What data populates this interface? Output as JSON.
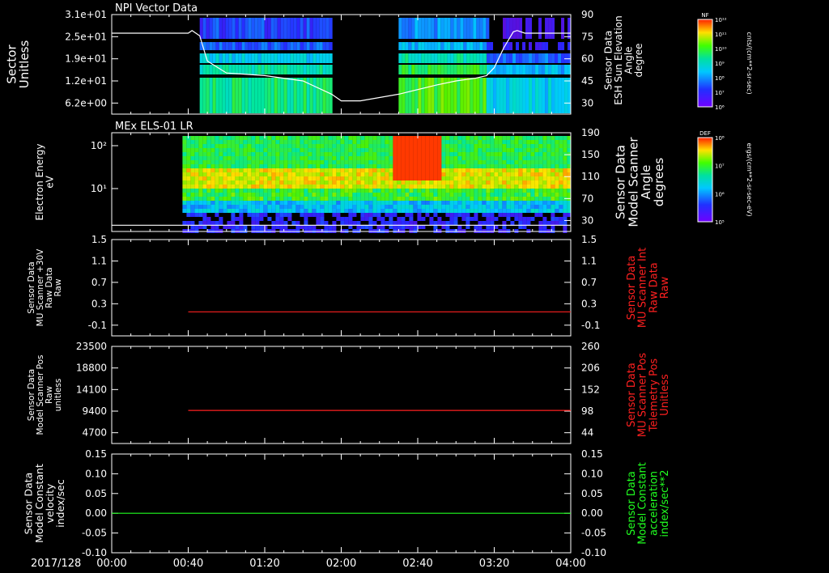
{
  "colors": {
    "background": "#000000",
    "axis": "#ffffff",
    "right_red": "#ff2020",
    "right_green": "#20ff20",
    "line_red": "#ff2020",
    "line_green": "#20ff20"
  },
  "date_label": "2017/128",
  "x_ticks": [
    "00:00",
    "00:40",
    "01:20",
    "02:00",
    "02:40",
    "03:20",
    "04:00"
  ],
  "chart_data": [
    {
      "type": "heatmap",
      "title": "NPI Vector Data",
      "ylabel_lines": [
        "Sector",
        "Unitless"
      ],
      "y_ticks": [
        "3.1e+01",
        "2.5e+01",
        "1.9e+01",
        "1.2e+01",
        "6.2e+00"
      ],
      "right_ylabel_lines": [
        "Sensor Data",
        "ESH Sun Elevation",
        "Angle",
        "degree"
      ],
      "right_ticks": [
        "90",
        "75",
        "60",
        "45",
        "30"
      ],
      "right_range": [
        15,
        90
      ],
      "colorbar": {
        "label": "NF",
        "unit": "cnts/(cm**2-sr-sec)",
        "tick_labels": [
          "10¹²",
          "10¹¹",
          "10¹⁰",
          "10⁹",
          "10⁸",
          "10⁷",
          "10⁶"
        ]
      },
      "line": {
        "x": [
          "00:00",
          "00:40",
          "00:42",
          "00:46",
          "00:50",
          "01:00",
          "01:20",
          "01:40",
          "01:55",
          "02:00",
          "02:10",
          "02:30",
          "02:50",
          "03:00",
          "03:10",
          "03:16",
          "03:20",
          "03:25",
          "03:30",
          "03:32",
          "03:36",
          "04:00"
        ],
        "y": [
          76,
          76,
          78,
          74,
          55,
          46,
          44,
          40,
          30,
          25,
          25,
          30,
          37,
          40,
          42,
          44,
          50,
          65,
          77,
          78,
          76,
          76
        ]
      }
    },
    {
      "type": "heatmap",
      "title": "MEx ELS-01 LR",
      "ylabel_lines": [
        "Electron Energy",
        "eV"
      ],
      "y_ticks": [
        "10²",
        "10¹"
      ],
      "right_ylabel_lines": [
        "Sensor Data",
        "Model Scanner",
        "Angle",
        "degrees"
      ],
      "right_ticks": [
        "190",
        "150",
        "110",
        "70",
        "30"
      ],
      "right_range": [
        0,
        190
      ],
      "colorbar": {
        "label": "DEF",
        "unit": "ergs/(cm**2-sr-sec-eV)",
        "tick_labels": [
          "10⁸",
          "10⁷",
          "10⁶",
          "10⁵"
        ]
      },
      "line": {
        "x": [
          "00:00",
          "04:00"
        ],
        "y": [
          12,
          12
        ]
      }
    },
    {
      "type": "line",
      "ylabel_lines": [
        "Sensor Data",
        "MU Scanner +30V",
        "Raw Data",
        "Raw"
      ],
      "y_ticks": [
        "1.5",
        "1.1",
        "0.7",
        "0.3",
        "-0.1"
      ],
      "y_range": [
        -0.5,
        1.5
      ],
      "right_ylabel_lines": [
        "Sensor Data",
        "MU Scanner Int",
        "Raw Data",
        "Raw"
      ],
      "right_ticks": [
        "1.5",
        "1.1",
        "0.7",
        "0.3",
        "-0.1"
      ],
      "series": [
        {
          "x": [
            "00:40",
            "04:00"
          ],
          "y": [
            0.0,
            0.0
          ]
        }
      ]
    },
    {
      "type": "line",
      "ylabel_lines": [
        "Sensor Data",
        "Model Scanner Pos",
        "Raw",
        "unitless"
      ],
      "y_ticks": [
        "23500",
        "18800",
        "14100",
        "9400",
        "4700"
      ],
      "y_range": [
        0,
        23500
      ],
      "right_ylabel_lines": [
        "Sensor Data",
        "MU Scanner Pos",
        "Telemetry Pos",
        "Unitless"
      ],
      "right_ticks": [
        "260",
        "206",
        "152",
        "98",
        "44"
      ],
      "series": [
        {
          "x": [
            "00:40",
            "04:00"
          ],
          "y": [
            8000,
            8000
          ]
        }
      ]
    },
    {
      "type": "line",
      "ylabel_lines": [
        "Sensor Data",
        "Model Constant",
        "velocity",
        "index/sec"
      ],
      "y_ticks": [
        "0.15",
        "0.10",
        "0.05",
        "0.00",
        "-0.05",
        "-0.10"
      ],
      "y_range": [
        -0.1,
        0.15
      ],
      "right_ylabel_lines": [
        "Sensor Data",
        "Model Constant",
        "acceleration",
        "index/sec**2"
      ],
      "right_ticks": [
        "0.15",
        "0.10",
        "0.05",
        "0.00",
        "-0.05",
        "-0.10"
      ],
      "series": [
        {
          "x": [
            "00:00",
            "04:00"
          ],
          "y": [
            0.0,
            0.0
          ]
        }
      ]
    }
  ]
}
